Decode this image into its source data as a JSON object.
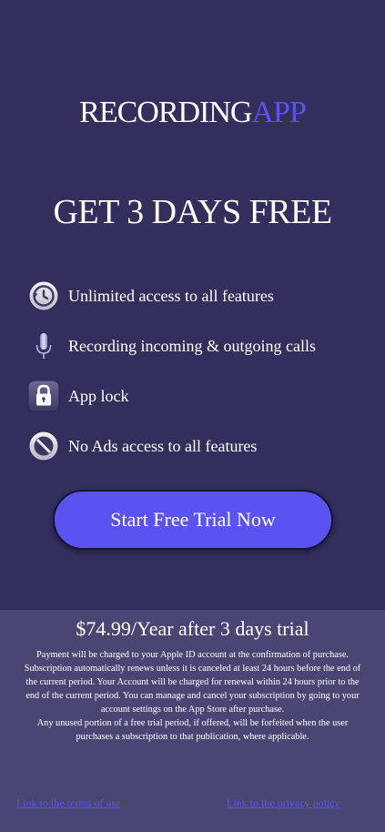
{
  "brand": {
    "name_main": "RECORDING",
    "name_accent": "APP",
    "accent_color": "#5b53f0"
  },
  "headline": "GET 3 DAYS FREE",
  "features": [
    {
      "icon": "history-clock-icon",
      "label": "Unlimited access to all features"
    },
    {
      "icon": "microphone-icon",
      "label": "Recording incoming & outgoing calls"
    },
    {
      "icon": "lock-icon",
      "label": "App lock"
    },
    {
      "icon": "no-ads-icon",
      "label": "No Ads access to all features"
    }
  ],
  "cta": {
    "label": "Start Free Trial Now"
  },
  "pricing": {
    "headline": "$74.99/Year after 3 days trial",
    "legal_1": "Payment will be charged to your Apple ID account at the confirmation of purchase. Subscription automatically renews unless it is canceled at least 24 hours before the end of the current period. Your Account will be charged for renewal within 24 hours prior to the end of the current period. You can manage and cancel your subscription by going to your account settings on the App Store after purchase.",
    "legal_2": "Any unused portion of a free trial period, if offered, will be forfeited when the user purchases a subscription to that publication, where applicable."
  },
  "links": {
    "terms": "Link to the terms of use",
    "privacy": "Link to the privacy policy"
  },
  "colors": {
    "background": "#322f5c",
    "footer_background": "#4a4674",
    "button": "#5b53f0"
  }
}
